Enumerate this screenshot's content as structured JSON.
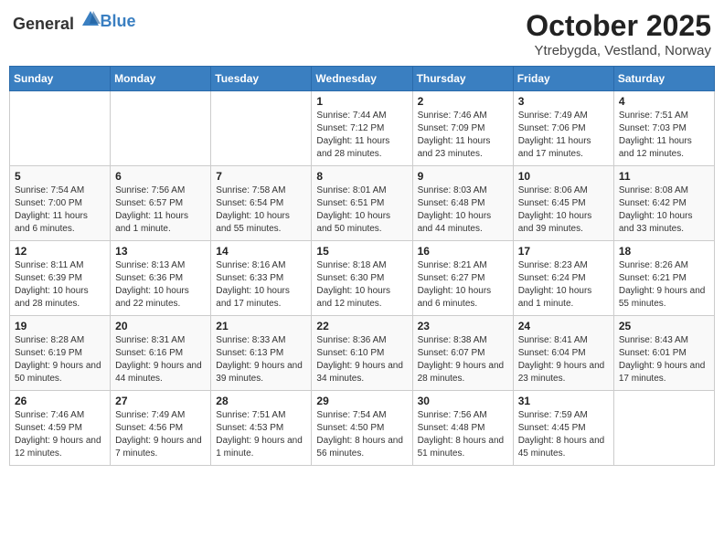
{
  "header": {
    "logo_general": "General",
    "logo_blue": "Blue",
    "month": "October 2025",
    "location": "Ytrebygda, Vestland, Norway"
  },
  "days_of_week": [
    "Sunday",
    "Monday",
    "Tuesday",
    "Wednesday",
    "Thursday",
    "Friday",
    "Saturday"
  ],
  "weeks": [
    [
      {
        "day": "",
        "content": ""
      },
      {
        "day": "",
        "content": ""
      },
      {
        "day": "",
        "content": ""
      },
      {
        "day": "1",
        "content": "Sunrise: 7:44 AM\nSunset: 7:12 PM\nDaylight: 11 hours\nand 28 minutes."
      },
      {
        "day": "2",
        "content": "Sunrise: 7:46 AM\nSunset: 7:09 PM\nDaylight: 11 hours\nand 23 minutes."
      },
      {
        "day": "3",
        "content": "Sunrise: 7:49 AM\nSunset: 7:06 PM\nDaylight: 11 hours\nand 17 minutes."
      },
      {
        "day": "4",
        "content": "Sunrise: 7:51 AM\nSunset: 7:03 PM\nDaylight: 11 hours\nand 12 minutes."
      }
    ],
    [
      {
        "day": "5",
        "content": "Sunrise: 7:54 AM\nSunset: 7:00 PM\nDaylight: 11 hours\nand 6 minutes."
      },
      {
        "day": "6",
        "content": "Sunrise: 7:56 AM\nSunset: 6:57 PM\nDaylight: 11 hours\nand 1 minute."
      },
      {
        "day": "7",
        "content": "Sunrise: 7:58 AM\nSunset: 6:54 PM\nDaylight: 10 hours\nand 55 minutes."
      },
      {
        "day": "8",
        "content": "Sunrise: 8:01 AM\nSunset: 6:51 PM\nDaylight: 10 hours\nand 50 minutes."
      },
      {
        "day": "9",
        "content": "Sunrise: 8:03 AM\nSunset: 6:48 PM\nDaylight: 10 hours\nand 44 minutes."
      },
      {
        "day": "10",
        "content": "Sunrise: 8:06 AM\nSunset: 6:45 PM\nDaylight: 10 hours\nand 39 minutes."
      },
      {
        "day": "11",
        "content": "Sunrise: 8:08 AM\nSunset: 6:42 PM\nDaylight: 10 hours\nand 33 minutes."
      }
    ],
    [
      {
        "day": "12",
        "content": "Sunrise: 8:11 AM\nSunset: 6:39 PM\nDaylight: 10 hours\nand 28 minutes."
      },
      {
        "day": "13",
        "content": "Sunrise: 8:13 AM\nSunset: 6:36 PM\nDaylight: 10 hours\nand 22 minutes."
      },
      {
        "day": "14",
        "content": "Sunrise: 8:16 AM\nSunset: 6:33 PM\nDaylight: 10 hours\nand 17 minutes."
      },
      {
        "day": "15",
        "content": "Sunrise: 8:18 AM\nSunset: 6:30 PM\nDaylight: 10 hours\nand 12 minutes."
      },
      {
        "day": "16",
        "content": "Sunrise: 8:21 AM\nSunset: 6:27 PM\nDaylight: 10 hours\nand 6 minutes."
      },
      {
        "day": "17",
        "content": "Sunrise: 8:23 AM\nSunset: 6:24 PM\nDaylight: 10 hours\nand 1 minute."
      },
      {
        "day": "18",
        "content": "Sunrise: 8:26 AM\nSunset: 6:21 PM\nDaylight: 9 hours\nand 55 minutes."
      }
    ],
    [
      {
        "day": "19",
        "content": "Sunrise: 8:28 AM\nSunset: 6:19 PM\nDaylight: 9 hours\nand 50 minutes."
      },
      {
        "day": "20",
        "content": "Sunrise: 8:31 AM\nSunset: 6:16 PM\nDaylight: 9 hours\nand 44 minutes."
      },
      {
        "day": "21",
        "content": "Sunrise: 8:33 AM\nSunset: 6:13 PM\nDaylight: 9 hours\nand 39 minutes."
      },
      {
        "day": "22",
        "content": "Sunrise: 8:36 AM\nSunset: 6:10 PM\nDaylight: 9 hours\nand 34 minutes."
      },
      {
        "day": "23",
        "content": "Sunrise: 8:38 AM\nSunset: 6:07 PM\nDaylight: 9 hours\nand 28 minutes."
      },
      {
        "day": "24",
        "content": "Sunrise: 8:41 AM\nSunset: 6:04 PM\nDaylight: 9 hours\nand 23 minutes."
      },
      {
        "day": "25",
        "content": "Sunrise: 8:43 AM\nSunset: 6:01 PM\nDaylight: 9 hours\nand 17 minutes."
      }
    ],
    [
      {
        "day": "26",
        "content": "Sunrise: 7:46 AM\nSunset: 4:59 PM\nDaylight: 9 hours\nand 12 minutes."
      },
      {
        "day": "27",
        "content": "Sunrise: 7:49 AM\nSunset: 4:56 PM\nDaylight: 9 hours\nand 7 minutes."
      },
      {
        "day": "28",
        "content": "Sunrise: 7:51 AM\nSunset: 4:53 PM\nDaylight: 9 hours\nand 1 minute."
      },
      {
        "day": "29",
        "content": "Sunrise: 7:54 AM\nSunset: 4:50 PM\nDaylight: 8 hours\nand 56 minutes."
      },
      {
        "day": "30",
        "content": "Sunrise: 7:56 AM\nSunset: 4:48 PM\nDaylight: 8 hours\nand 51 minutes."
      },
      {
        "day": "31",
        "content": "Sunrise: 7:59 AM\nSunset: 4:45 PM\nDaylight: 8 hours\nand 45 minutes."
      },
      {
        "day": "",
        "content": ""
      }
    ]
  ]
}
